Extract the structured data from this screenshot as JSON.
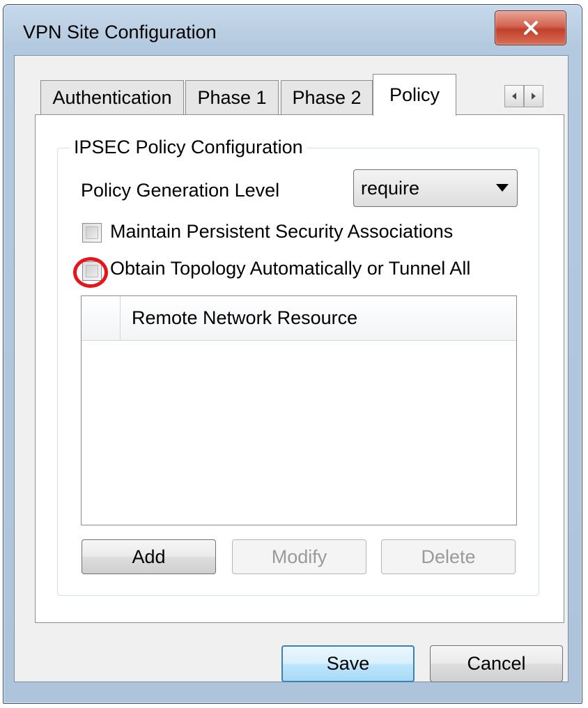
{
  "window": {
    "title": "VPN Site Configuration",
    "close_label": "X"
  },
  "tabs": [
    {
      "label": "Authentication",
      "active": false
    },
    {
      "label": "Phase 1",
      "active": false
    },
    {
      "label": "Phase 2",
      "active": false
    },
    {
      "label": "Policy",
      "active": true
    }
  ],
  "tab_scroll": {
    "left_icon": "scroll-left-icon",
    "right_icon": "scroll-right-icon"
  },
  "policy": {
    "group_label": "IPSEC Policy Configuration",
    "generation_level_label": "Policy Generation Level",
    "generation_level_value": "require",
    "maintain_sa_label": "Maintain Persistent Security Associations",
    "maintain_sa_checked": false,
    "obtain_topology_label": "Obtain Topology Automatically or Tunnel All",
    "obtain_topology_checked": false,
    "resource_list": {
      "column_header": "Remote Network Resource",
      "rows": []
    },
    "buttons": {
      "add": "Add",
      "modify": "Modify",
      "delete": "Delete"
    }
  },
  "footer": {
    "save": "Save",
    "cancel": "Cancel"
  },
  "colors": {
    "highlight": "#e8141b",
    "default_button_border": "#3c7fb1",
    "close_button": "#c0402b"
  }
}
